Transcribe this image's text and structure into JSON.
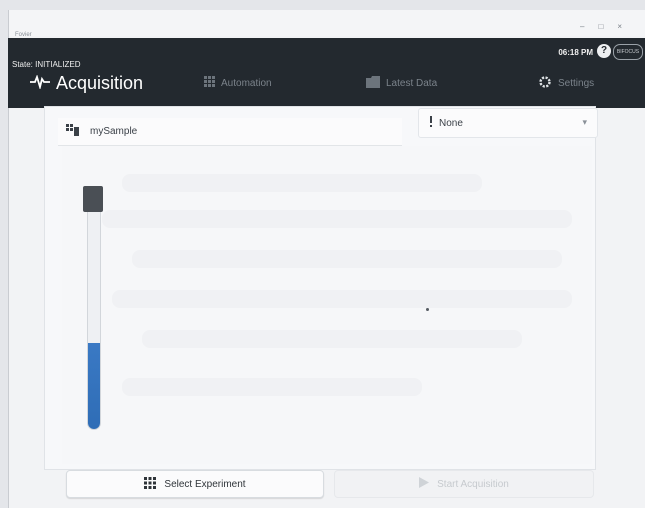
{
  "window": {
    "app_name": "Fovier",
    "controls": [
      "–",
      "□",
      "×"
    ]
  },
  "header": {
    "state": "State: INITIALIZED",
    "time": "06:18 PM",
    "help": "?",
    "brand": "BIFOCUS"
  },
  "tabs": [
    {
      "label": "Acquisition",
      "icon": "waveform-icon",
      "active": true
    },
    {
      "label": "Automation",
      "icon": "grid-icon",
      "active": false
    },
    {
      "label": "Latest Data",
      "icon": "folder-icon",
      "active": false
    },
    {
      "label": "Settings",
      "icon": "gear-icon",
      "active": false
    }
  ],
  "sample": {
    "label": "mySample",
    "icon": "sample-icon"
  },
  "selector": {
    "value": "None",
    "icon": "info-icon"
  },
  "fill_level_percent": 36,
  "buttons": {
    "select_experiment": "Select Experiment",
    "start_acquisition": "Start Acquisition"
  },
  "colors": {
    "header_bg": "#23292f",
    "fill": "#2f6db6",
    "panel_bg": "#f6f7f9"
  }
}
